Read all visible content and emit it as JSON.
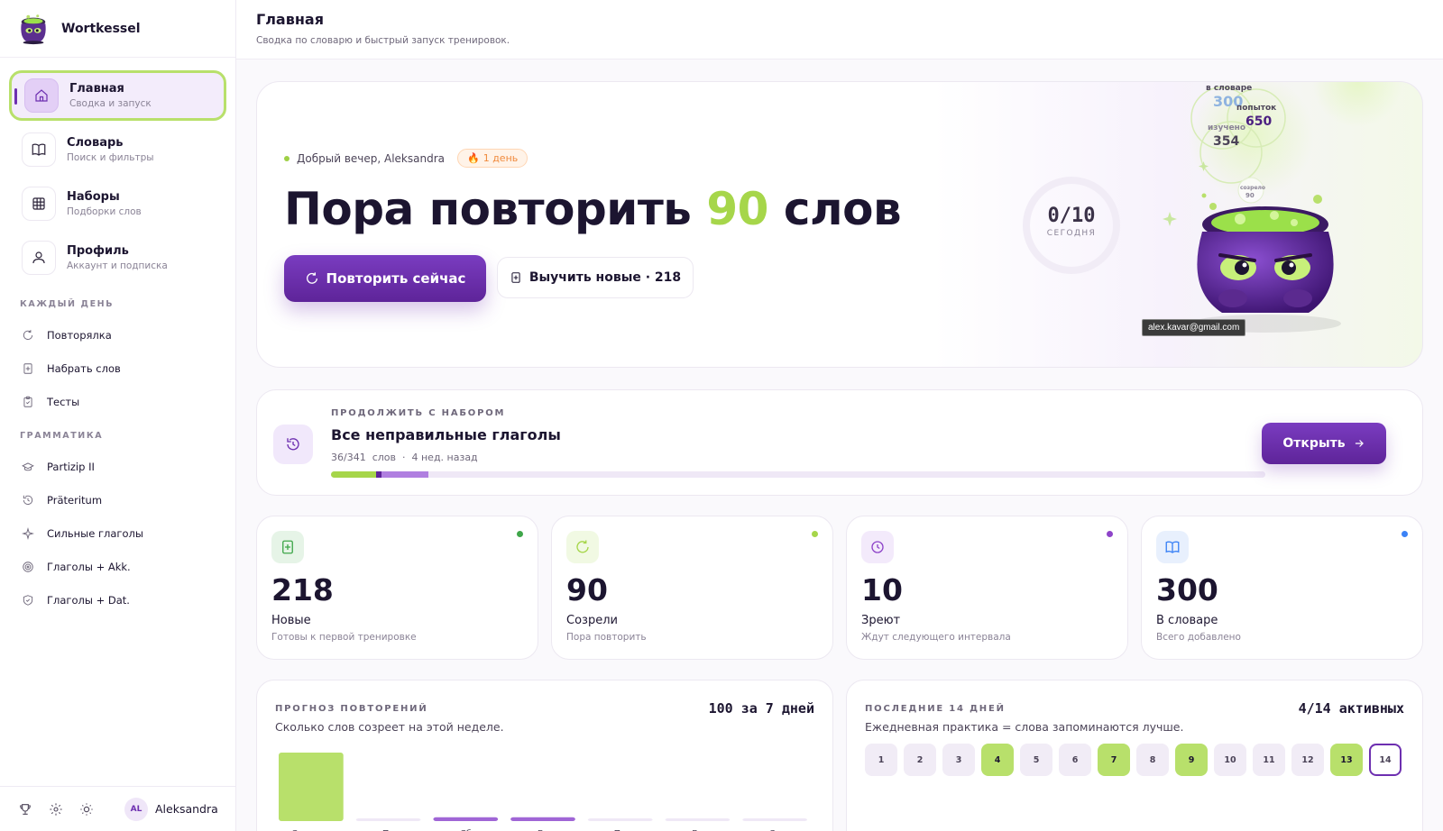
{
  "app": {
    "name": "Wortkessel"
  },
  "sidebar": {
    "nav": [
      {
        "title": "Главная",
        "sub": "Сводка и запуск"
      },
      {
        "title": "Словарь",
        "sub": "Поиск и фильтры"
      },
      {
        "title": "Наборы",
        "sub": "Подборки слов"
      },
      {
        "title": "Профиль",
        "sub": "Аккаунт и подписка"
      }
    ],
    "daily_label": "КАЖДЫЙ ДЕНЬ",
    "daily": [
      "Повторялка",
      "Набрать слов",
      "Тесты"
    ],
    "grammar_label": "ГРАММАТИКА",
    "grammar": [
      "Partizip II",
      "Präteritum",
      "Сильные глаголы",
      "Глаголы + Akk.",
      "Глаголы + Dat."
    ],
    "user": {
      "initials": "AL",
      "name": "Aleksandra"
    }
  },
  "header": {
    "title": "Главная",
    "subtitle": "Сводка по словарю и быстрый запуск тренировок."
  },
  "hero": {
    "greeting": "Добрый вечер, Aleksandra",
    "streak": "1 день",
    "headline_before": "Пора повторить ",
    "headline_number": "90",
    "headline_after": " слов",
    "primary_button": "Повторить сейчас",
    "secondary_button": "Выучить новые · 218",
    "progress": {
      "value": "0/10",
      "label": "СЕГОДНЯ",
      "fraction": 0
    },
    "tooltip": "alex.kavar@gmail.com",
    "bubbles": {
      "in_dict_label": "в словаре",
      "in_dict_value": "300",
      "attempts_label": "попыток",
      "attempts_value": "650",
      "learned_label": "изучено",
      "learned_value": "354",
      "ripe_label": "созрело",
      "ripe_value": "90"
    }
  },
  "continue": {
    "label": "ПРОДОЛЖИТЬ С НАБОРОМ",
    "title": "Все неправильные глаголы",
    "count": "36/341",
    "unit": "слов",
    "ago": "4 нед. назад",
    "button": "Открыть",
    "progress": {
      "green": 0.048,
      "dark": 0.006,
      "purple": 0.05
    }
  },
  "stats": [
    {
      "value": "218",
      "name": "Новые",
      "desc": "Готовы к первой тренировке",
      "color": "#3fa64a",
      "icon": "book-plus-icon"
    },
    {
      "value": "90",
      "name": "Созрели",
      "desc": "Пора повторить",
      "color": "#a6d64a",
      "icon": "refresh-icon"
    },
    {
      "value": "10",
      "name": "Зреют",
      "desc": "Ждут следующего интервала",
      "color": "#8e44c9",
      "icon": "clock-icon"
    },
    {
      "value": "300",
      "name": "В словаре",
      "desc": "Всего добавлено",
      "color": "#3b82f6",
      "icon": "open-book-icon"
    }
  ],
  "forecast": {
    "label": "ПРОГНОЗ ПОВТОРЕНИЙ",
    "desc": "Сколько слов созреет на этой неделе.",
    "total": "100 за 7 дней"
  },
  "chart_data": {
    "type": "bar",
    "categories": [
      "Сегодня",
      "Пт",
      "Сб",
      "Вс",
      "Пн",
      "Вт",
      "Ср"
    ],
    "values": [
      90,
      0,
      5,
      5,
      0,
      0,
      0
    ]
  },
  "activity": {
    "label": "ПОСЛЕДНИЕ 14 ДНЕЙ",
    "desc": "Ежедневная практика = слова запоминаются лучше.",
    "total": "4/14 активных",
    "days": [
      {
        "n": "1",
        "active": false
      },
      {
        "n": "2",
        "active": false
      },
      {
        "n": "3",
        "active": false
      },
      {
        "n": "4",
        "active": true
      },
      {
        "n": "5",
        "active": false
      },
      {
        "n": "6",
        "active": false
      },
      {
        "n": "7",
        "active": true
      },
      {
        "n": "8",
        "active": false
      },
      {
        "n": "9",
        "active": true
      },
      {
        "n": "10",
        "active": false
      },
      {
        "n": "11",
        "active": false
      },
      {
        "n": "12",
        "active": false
      },
      {
        "n": "13",
        "active": true
      },
      {
        "n": "14",
        "active": false,
        "today": true
      }
    ]
  },
  "colors": {
    "brand": "#6d2fb0",
    "accent": "#a6d64a"
  }
}
